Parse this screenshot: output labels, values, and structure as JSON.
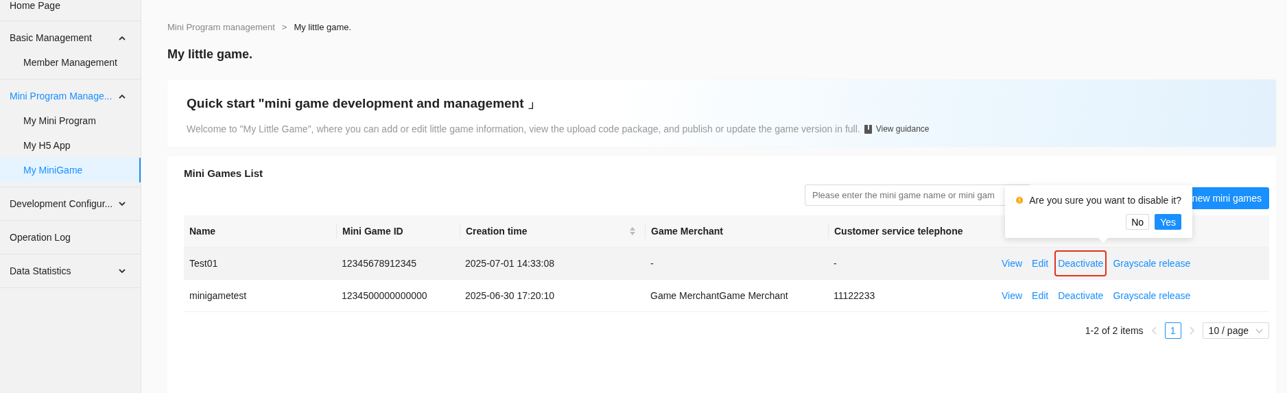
{
  "sidebar": {
    "items": [
      {
        "label": "Home Page",
        "kind": "link",
        "selected": false
      },
      {
        "label": "Basic Management",
        "kind": "group",
        "selected": false,
        "expanded": true,
        "children": [
          {
            "label": "Member Management",
            "selected": false
          }
        ]
      },
      {
        "label": "Mini Program Manage...",
        "kind": "group",
        "selected": true,
        "expanded": true,
        "children": [
          {
            "label": "My Mini Program",
            "selected": false
          },
          {
            "label": "My H5 App",
            "selected": false
          },
          {
            "label": "My MiniGame",
            "selected": true
          }
        ]
      },
      {
        "label": "Development Configur...",
        "kind": "group",
        "selected": false,
        "expanded": false
      },
      {
        "label": "Operation Log",
        "kind": "link",
        "selected": false
      },
      {
        "label": "Data Statistics",
        "kind": "group",
        "selected": false,
        "expanded": false
      }
    ]
  },
  "breadcrumb": {
    "items": [
      "Mini Program management",
      "My little game."
    ],
    "separator": ">"
  },
  "page_title": "My little game.",
  "quick_start": {
    "title": "Quick start \"mini game development and management 」",
    "description": "Welcome to \"My Little Game\", where you can add or edit little game information, view the upload code package, and publish or update the game version in full.",
    "link": "View guidance"
  },
  "list": {
    "title": "Mini Games List",
    "search": {
      "placeholder": "Please enter the mini game name or mini gam"
    },
    "add_button": "new mini games",
    "table": {
      "columns": [
        "Name",
        "Mini Game ID",
        "Creation time",
        "Game Merchant",
        "Customer service telephone"
      ],
      "rows": [
        {
          "cells": [
            "Test01",
            "12345678912345",
            "2025-07-01 14:33:08",
            "-",
            "-"
          ],
          "hovered": true,
          "actions": [
            {
              "label": "View",
              "highlighted": false
            },
            {
              "label": "Edit",
              "highlighted": false
            },
            {
              "label": "Deactivate",
              "highlighted": true
            },
            {
              "label": "Grayscale release",
              "highlighted": false
            }
          ]
        },
        {
          "cells": [
            "minigametest",
            "1234500000000000",
            "2025-06-30 17:20:10",
            "Game MerchantGame Merchant",
            "11122233"
          ],
          "hovered": false,
          "actions": [
            {
              "label": "View",
              "highlighted": false
            },
            {
              "label": "Edit",
              "highlighted": false
            },
            {
              "label": "Deactivate",
              "highlighted": false
            },
            {
              "label": "Grayscale release",
              "highlighted": false
            }
          ]
        }
      ]
    },
    "pagination": {
      "summary": "1-2 of 2 items",
      "pages": [
        {
          "label": "1",
          "selected": true
        }
      ],
      "page_size": "10 / page"
    }
  },
  "popconfirm": {
    "message": "Are you sure you want to disable it?",
    "buttons": [
      {
        "label": "No",
        "kind": "default"
      },
      {
        "label": "Yes",
        "kind": "primary"
      }
    ]
  }
}
